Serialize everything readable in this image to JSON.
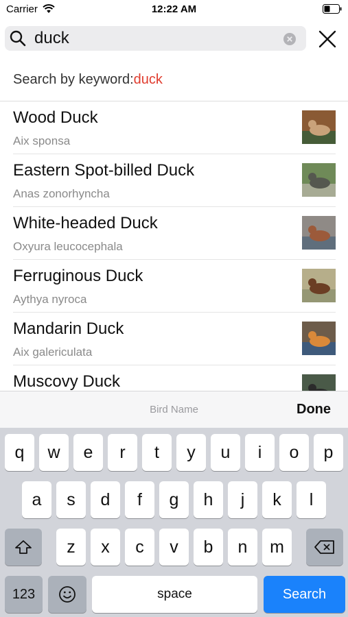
{
  "status_bar": {
    "carrier": "Carrier",
    "time": "12:22 AM"
  },
  "search": {
    "query": "duck"
  },
  "keyword_header": {
    "prefix": "Search by keyword:",
    "term": "duck"
  },
  "results": [
    {
      "name": "Wood Duck",
      "latin": "Aix sponsa",
      "thumb_colors": [
        "#8a5a34",
        "#c9a27a",
        "#2f5e3a"
      ]
    },
    {
      "name": "Eastern Spot-billed Duck",
      "latin": "Anas zonorhyncha",
      "thumb_colors": [
        "#6f8a58",
        "#55584f",
        "#b9b6a8"
      ]
    },
    {
      "name": "White-headed Duck",
      "latin": "Oxyura leucocephala",
      "thumb_colors": [
        "#8f8a86",
        "#9c5a3a",
        "#4f6478"
      ]
    },
    {
      "name": "Ferruginous Duck",
      "latin": "Aythya nyroca",
      "thumb_colors": [
        "#b6ae8a",
        "#6b3e24",
        "#8a8f6c"
      ]
    },
    {
      "name": "Mandarin Duck",
      "latin": "Aix galericulata",
      "thumb_colors": [
        "#6d5c4a",
        "#d9893a",
        "#2f5a8c"
      ]
    },
    {
      "name": "Muscovy Duck",
      "latin": "",
      "thumb_colors": [
        "#4a5a48",
        "#2b2b2b",
        "#8c9a82"
      ]
    }
  ],
  "accessory_bar": {
    "title": "Bird Name",
    "done_label": "Done"
  },
  "keyboard": {
    "row1": [
      "q",
      "w",
      "e",
      "r",
      "t",
      "y",
      "u",
      "i",
      "o",
      "p"
    ],
    "row2": [
      "a",
      "s",
      "d",
      "f",
      "g",
      "h",
      "j",
      "k",
      "l"
    ],
    "row3": [
      "z",
      "x",
      "c",
      "v",
      "b",
      "n",
      "m"
    ],
    "numbers_label": "123",
    "space_label": "space",
    "search_label": "Search"
  },
  "colors": {
    "keyword_accent": "#e03c2e",
    "search_key": "#1a82fb"
  }
}
